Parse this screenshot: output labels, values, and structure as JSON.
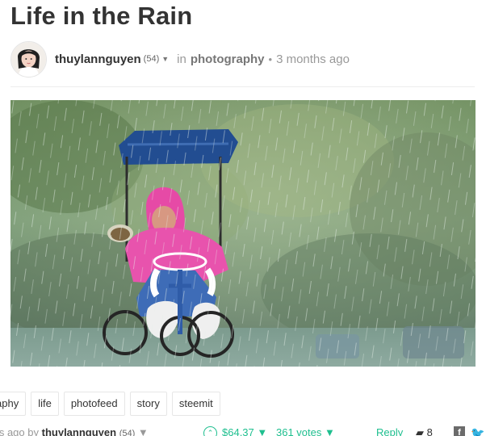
{
  "post": {
    "title": "Life in the Rain",
    "author": "thuylannguyen",
    "reputation": "(54)",
    "in_label": "in",
    "category": "photography",
    "separator": "•",
    "age": "3 months ago"
  },
  "tags": [
    "aphy",
    "life",
    "photofeed",
    "story",
    "steemit"
  ],
  "footer": {
    "age_prefix": "ths ago by",
    "author": "thuylannguyen",
    "reputation": "(54)",
    "upvote_glyph": "⌃",
    "payout": "$64.37",
    "votes": "361 votes",
    "reply": "Reply",
    "comment_count": "8",
    "facebook_icon": "facebook-icon",
    "twitter_icon": "twitter-icon"
  },
  "colors": {
    "accent": "#1fbf8f",
    "title": "#333333",
    "muted": "#999999"
  }
}
